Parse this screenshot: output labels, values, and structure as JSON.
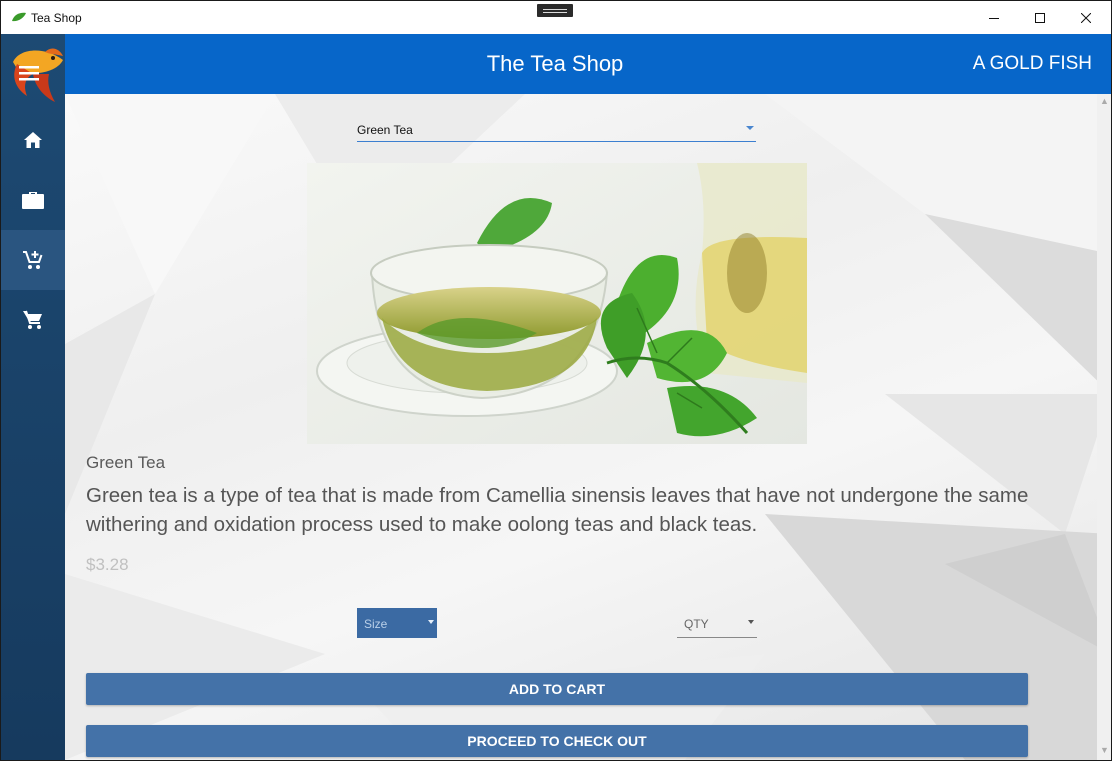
{
  "window": {
    "title": "Tea Shop",
    "controls": [
      "minimize",
      "maximize",
      "close"
    ]
  },
  "header": {
    "title": "The Tea Shop",
    "user": "A GOLD FISH"
  },
  "sidebar": {
    "items": [
      {
        "icon": "home-icon"
      },
      {
        "icon": "briefcase-icon"
      },
      {
        "icon": "add-to-cart-icon",
        "active": true
      },
      {
        "icon": "cart-icon"
      }
    ]
  },
  "product": {
    "selected_tea": "Green Tea",
    "name": "Green Tea",
    "description": "Green tea is a type of tea that is made from Camellia sinensis leaves that have not undergone the same withering and oxidation process used to make oolong teas and black teas.",
    "price": "$3.28",
    "size_placeholder": "Size",
    "qty_placeholder": "QTY"
  },
  "actions": {
    "add_to_cart": "ADD TO CART",
    "checkout": "PROCEED TO CHECK OUT"
  },
  "colors": {
    "header": "#0766c9",
    "sidebar": "#1d4a73",
    "button": "#4472a8"
  }
}
